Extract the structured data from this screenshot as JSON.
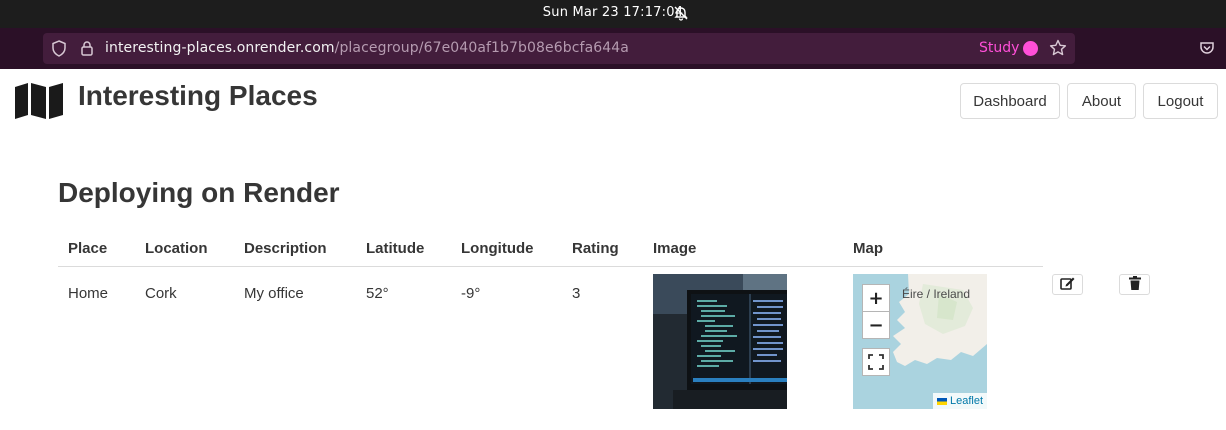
{
  "os": {
    "clock": "Sun Mar 23  17:17:04",
    "icons": [
      "notifications-off-icon"
    ]
  },
  "browser": {
    "url_host": "interesting-places.onrender.com",
    "url_path": "/placegroup/67e040af1b7b08e6bcfa644a",
    "study_label": "Study",
    "accent_color": "#ff4fd8",
    "icons": [
      "shield-icon",
      "lock-icon",
      "bookmark-star-icon",
      "pocket-icon"
    ]
  },
  "app": {
    "title": "Interesting Places",
    "logo_icon": "map-icon",
    "nav": {
      "dashboard": "Dashboard",
      "about": "About",
      "logout": "Logout"
    }
  },
  "page": {
    "title": "Deploying on Render"
  },
  "table": {
    "headers": [
      "Place",
      "Location",
      "Description",
      "Latitude",
      "Longitude",
      "Rating",
      "Image",
      "Map"
    ],
    "rows": [
      {
        "place": "Home",
        "location": "Cork",
        "description": "My office",
        "latitude": "52°",
        "longitude": "-9°",
        "rating": "3",
        "image": "laptop-with-code-photo",
        "map": {
          "label": "Éire / Ireland",
          "zoom_in": "+",
          "zoom_out": "−",
          "attribution": "Leaflet",
          "icons": [
            "fullscreen-icon",
            "ukraine-flag-icon"
          ]
        },
        "actions": [
          "edit-icon",
          "trash-icon"
        ]
      }
    ]
  }
}
